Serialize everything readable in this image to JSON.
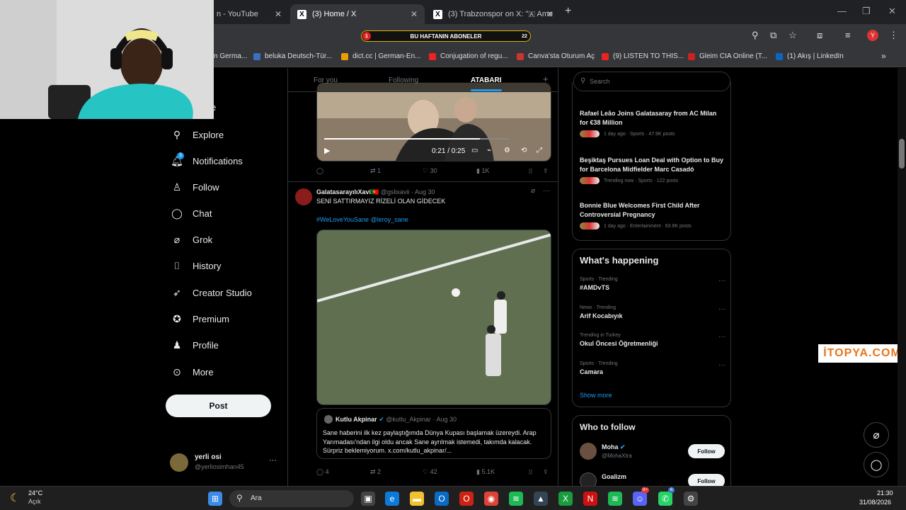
{
  "browser": {
    "tabs": [
      {
        "title": "n - YouTube"
      },
      {
        "title": "(3) Home / X"
      },
      {
        "title": "(3) Trabzonspor on X: \"🇦 Ame"
      }
    ],
    "new_tab": "+",
    "window_controls": {
      "minimize": "—",
      "maximize": "❐",
      "close": "✕"
    },
    "sub_banner": {
      "label": "BU HAFTANIN ABONELER",
      "left_num": "1",
      "right_num": "22"
    },
    "bookmarks": [
      {
        "label": "n Germa..."
      },
      {
        "label": "beluka Deutsch-Tür..."
      },
      {
        "label": "dict.cc | German-En..."
      },
      {
        "label": "Conjugation of regu..."
      },
      {
        "label": "Canva'sta Oturum Aç"
      },
      {
        "label": "(9) LISTEN TO THIS..."
      },
      {
        "label": "Gleim CIA Online (T..."
      },
      {
        "label": "(1) Akış | LinkedIn"
      }
    ],
    "more_bookmarks": "»",
    "profile_initial": "Y"
  },
  "sidebar": {
    "partial_label": "e",
    "items": [
      {
        "label": "Explore",
        "icon": "search-icon"
      },
      {
        "label": "Notifications",
        "icon": "bell-icon",
        "badge": "3"
      },
      {
        "label": "Follow",
        "icon": "person-plus-icon"
      },
      {
        "label": "Chat",
        "icon": "chat-icon"
      },
      {
        "label": "Grok",
        "icon": "grok-icon"
      },
      {
        "label": "History",
        "icon": "bookmark-icon"
      },
      {
        "label": "Creator Studio",
        "icon": "rocket-icon"
      },
      {
        "label": "Premium",
        "icon": "verified-icon"
      },
      {
        "label": "Profile",
        "icon": "person-icon"
      },
      {
        "label": "More",
        "icon": "more-circle-icon"
      }
    ],
    "post_button": "Post",
    "account": {
      "name": "yerli osi",
      "handle": "@yerliosimhan45",
      "more": "···"
    }
  },
  "feed": {
    "tabs": [
      "For you",
      "Following",
      "ATABARI"
    ],
    "add_tab": "+",
    "video1": {
      "time": "0:21 / 0:25"
    },
    "tweet1_actions": {
      "reply": "",
      "repost": "1",
      "like": "30",
      "views": "1K"
    },
    "tweet2": {
      "name": "GalatasarayılıXavi🇵🇹",
      "handle": "@gslixavii",
      "date": "· Aug 30",
      "text": "SENİ SATTIRMAYIZ RİZELİ OLAN GİDECEK",
      "hashtags": "#WeLoveYouSane @leroy_sane",
      "quote": {
        "name": "Kutlu Akpinar",
        "handle": "@kutlu_Akpinar",
        "date": "· Aug 30",
        "text": "Sane haberini ilk kez paylaştığımda Dünya Kupası başlamak üzereydi. Arap Yarımadası'ndan ilgi oldu ancak Sane ayrılmak istemedi, takımda kalacak. Sürpriz beklemiyorum. x.com/kutlu_akpinar/..."
      },
      "actions": {
        "reply": "4",
        "repost": "2",
        "like": "42",
        "views": "5.1K"
      }
    }
  },
  "right": {
    "search_placeholder": "Search",
    "news": [
      {
        "headline": "Rafael Leão Joins Galatasaray from AC Milan for €38 Million",
        "meta": "1 day ago · Sports · 47.9K posts"
      },
      {
        "headline": "Beşiktaş Pursues Loan Deal with Option to Buy for Barcelona Midfielder Marc Casadó",
        "meta": "Trending now · Sports · 122 posts"
      },
      {
        "headline": "Bonnie Blue Welcomes First Child After Controversial Pregnancy",
        "meta": "1 day ago · Entertainment · 63.8K posts"
      }
    ],
    "whats_happening": {
      "title": "What's happening",
      "trends": [
        {
          "meta": "Sports · Trending",
          "name": "#AMDvTS"
        },
        {
          "meta": "News · Trending",
          "name": "Arif Kocabıyık"
        },
        {
          "meta": "Trending in Turkey",
          "name": "Okul Öncesi Öğretmenliği"
        },
        {
          "meta": "Sports · Trending",
          "name": "Camara"
        }
      ],
      "show_more": "Show more"
    },
    "who_to_follow": {
      "title": "Who to follow",
      "users": [
        {
          "name": "Moha",
          "handle": "@MohaXtra",
          "button": "Follow"
        },
        {
          "name": "Goalizm",
          "handle": "",
          "button": "Follow"
        }
      ]
    }
  },
  "watermark": "İTOPYA.COM",
  "taskbar": {
    "weather_temp": "24°C",
    "weather_desc": "Açık",
    "search_placeholder": "Ara",
    "time": "21:30",
    "date": "31/08/2026",
    "discord_badge": "9+",
    "whatsapp_badge": "6"
  }
}
